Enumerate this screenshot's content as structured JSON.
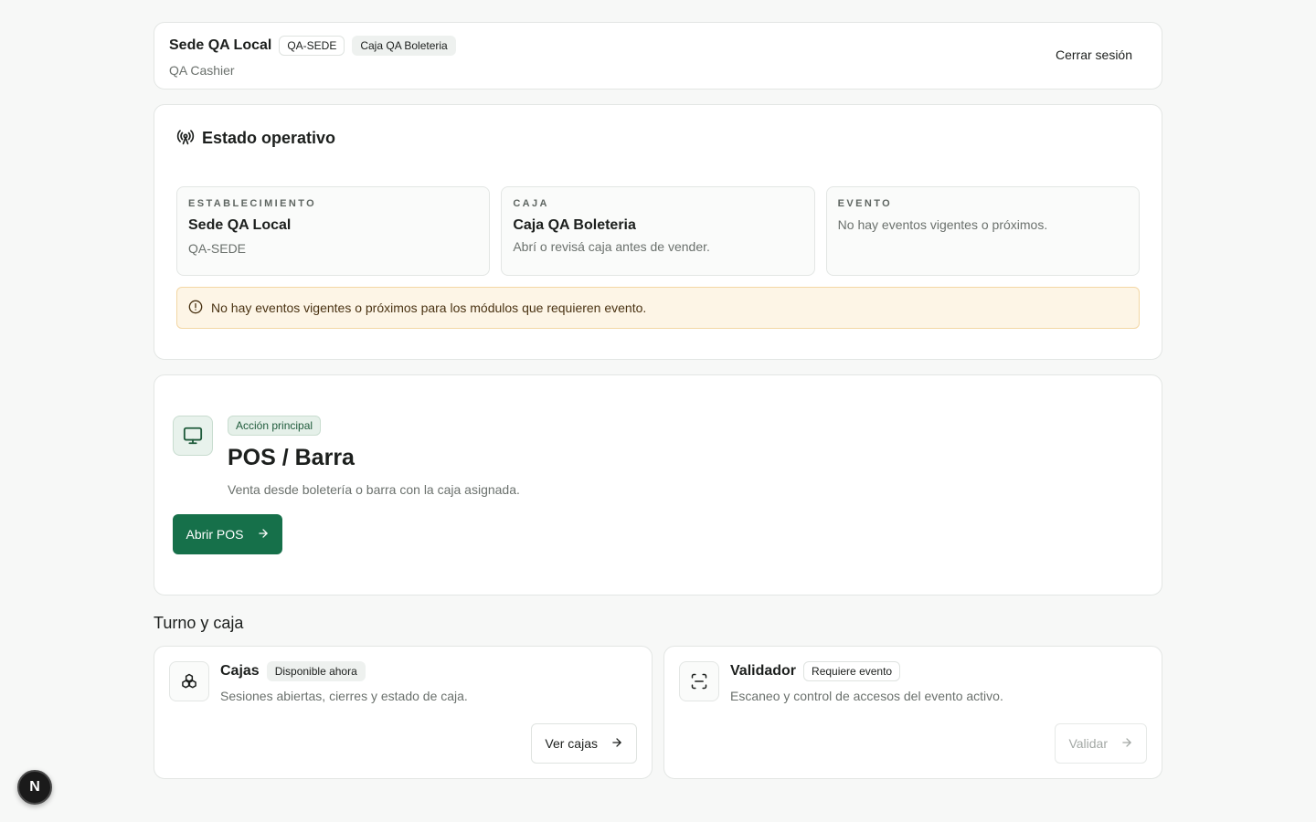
{
  "header": {
    "site_name": "Sede QA Local",
    "site_code": "QA-SEDE",
    "register_name": "Caja QA Boleteria",
    "user": "QA Cashier",
    "logout_label": "Cerrar sesión"
  },
  "status": {
    "title": "Estado operativo",
    "establishment": {
      "label": "ESTABLECIMIENTO",
      "name": "Sede QA Local",
      "code": "QA-SEDE"
    },
    "register": {
      "label": "CAJA",
      "name": "Caja QA Boleteria",
      "hint": "Abrí o revisá caja antes de vender."
    },
    "event": {
      "label": "EVENTO",
      "message": "No hay eventos vigentes o próximos."
    },
    "alert": "No hay eventos vigentes o próximos para los módulos que requieren evento."
  },
  "pos": {
    "badge": "Acción principal",
    "title": "POS / Barra",
    "description": "Venta desde boletería o barra con la caja asignada.",
    "button_label": "Abrir POS"
  },
  "shift_section": {
    "title": "Turno y caja",
    "modules": [
      {
        "name": "Cajas",
        "badge": "Disponible ahora",
        "description": "Sesiones abiertas, cierres y estado de caja.",
        "button_label": "Ver cajas",
        "icon": "boxes-icon",
        "enabled": true
      },
      {
        "name": "Validador",
        "badge": "Requiere evento",
        "description": "Escaneo y control de accesos del evento activo.",
        "button_label": "Validar",
        "icon": "scan-icon",
        "enabled": false
      }
    ]
  },
  "dev_badge": "N",
  "colors": {
    "primary": "#16704a",
    "alert_bg": "#fdf5e6",
    "alert_border": "#f3d7a5"
  }
}
